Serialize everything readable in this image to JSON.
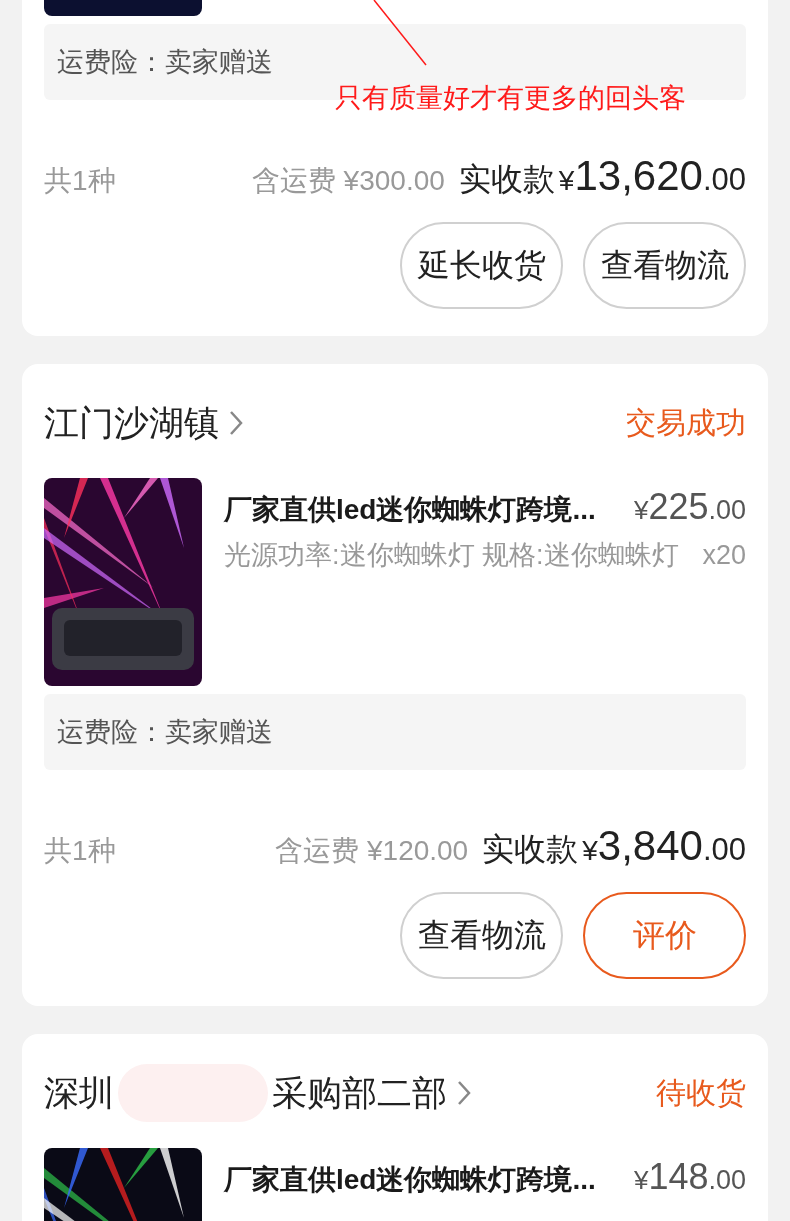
{
  "annotation": {
    "text": "只有质量好才有更多的回头客"
  },
  "orders": [
    {
      "products": [
        {
          "image": {
            "kind": "picture"
          }
        }
      ],
      "freight_insurance": "运费险：卖家赠送",
      "item_count": "共1种",
      "shipping_label": "含运费",
      "shipping_amount": "¥300.00",
      "total_label": "实收款",
      "total": {
        "currency": "¥",
        "whole": "13,620",
        "decimal": ".00"
      },
      "buttons": [
        {
          "label": "延长收货",
          "primary": false
        },
        {
          "label": "查看物流",
          "primary": false
        }
      ]
    },
    {
      "shop_name_parts": [
        "江门沙湖镇"
      ],
      "status": "交易成功",
      "products": [
        {
          "image": {
            "kind": "picture"
          },
          "title": "厂家直供led迷你蜘蛛灯跨境...",
          "price": {
            "currency": "¥",
            "whole": "225",
            "decimal": ".00"
          },
          "spec": "光源功率:迷你蜘蛛灯 规格:迷你蜘蛛灯",
          "quantity": "x20"
        }
      ],
      "freight_insurance": "运费险：卖家赠送",
      "item_count": "共1种",
      "shipping_label": "含运费",
      "shipping_amount": "¥120.00",
      "total_label": "实收款",
      "total": {
        "currency": "¥",
        "whole": "3,840",
        "decimal": ".00"
      },
      "buttons": [
        {
          "label": "查看物流",
          "primary": false
        },
        {
          "label": "评价",
          "primary": true
        }
      ]
    },
    {
      "shop_name_parts": [
        "深圳",
        "采购部二部"
      ],
      "status": "待收货",
      "products": [
        {
          "image": {
            "kind": "picture"
          },
          "title": "厂家直供led迷你蜘蛛灯跨境...",
          "price": {
            "currency": "¥",
            "whole": "148",
            "decimal": ".00"
          }
        }
      ]
    }
  ]
}
